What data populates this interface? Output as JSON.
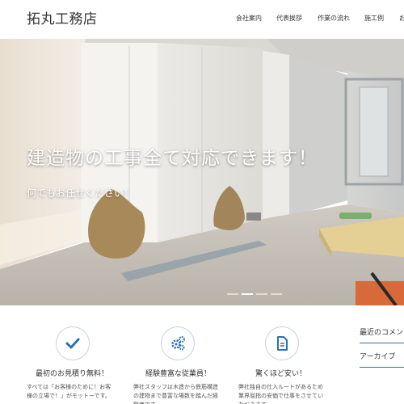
{
  "site": {
    "title": "拓丸工務店"
  },
  "nav": {
    "items": [
      {
        "label": "会社案内"
      },
      {
        "label": "代表挨拶"
      },
      {
        "label": "作業の流れ"
      },
      {
        "label": "施工例"
      },
      {
        "label": "お"
      }
    ]
  },
  "hero": {
    "headline": "建造物の工事全て対応できます！",
    "subheadline": "何でもお任せください！",
    "slide_count": 4,
    "active_slide": 2
  },
  "features": [
    {
      "icon": "checkmark-icon",
      "title": "最初のお見積り無料！",
      "text": "すべては「お客様のために！お客様の立場で！」がモットーです。"
    },
    {
      "icon": "gears-icon",
      "title": "経験豊富な従業員！",
      "text": "弊社スタッフは木造から鉄筋構造の建物まで豊富な場数を踏んだ経験者です。"
    },
    {
      "icon": "document-icon",
      "title": "驚くほど安い！",
      "text": "弊社独自の仕入ルートがあるため業界屈指の安価で仕事をさせていただきます。"
    }
  ],
  "sidebar": {
    "recent_comments": "最近のコメント",
    "archives": "アーカイブ"
  },
  "colors": {
    "accent": "#2c6fb3",
    "icon_border": "#c9d3dd"
  }
}
